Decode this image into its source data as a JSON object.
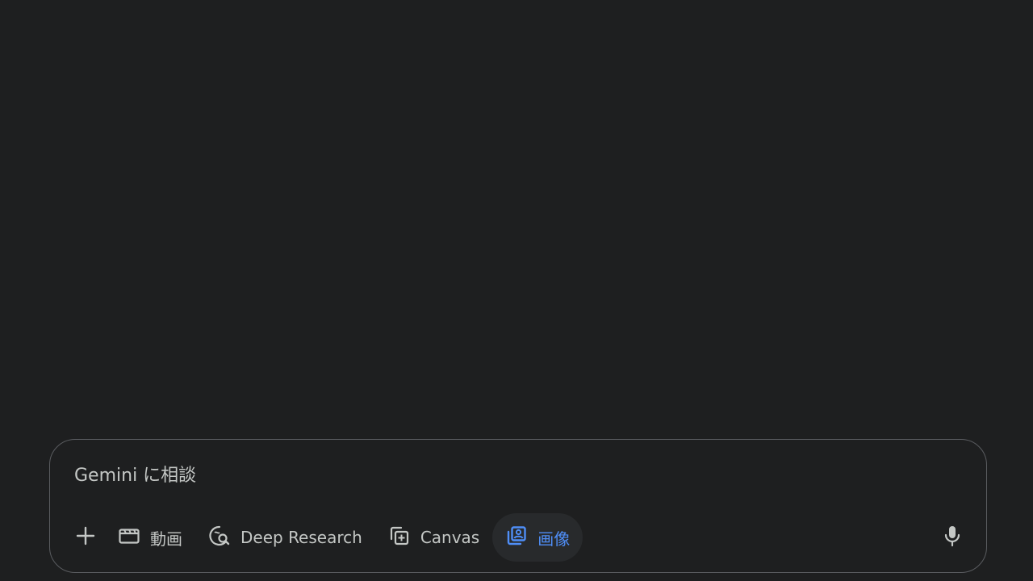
{
  "prompt": {
    "placeholder": "Gemini に相談",
    "value": ""
  },
  "toolbar": {
    "add_icon": "plus-icon",
    "tools": [
      {
        "label": "動画",
        "icon": "film-icon",
        "active": false
      },
      {
        "label": "Deep Research",
        "icon": "deep-research-icon",
        "active": false
      },
      {
        "label": "Canvas",
        "icon": "canvas-icon",
        "active": false
      },
      {
        "label": "画像",
        "icon": "image-icon",
        "active": true
      }
    ],
    "mic_icon": "microphone-icon"
  },
  "colors": {
    "background": "#1e1f20",
    "active_chip_text": "#4f8ef7",
    "active_chip_bg": "#282a2c",
    "text": "#c4c7c5"
  }
}
